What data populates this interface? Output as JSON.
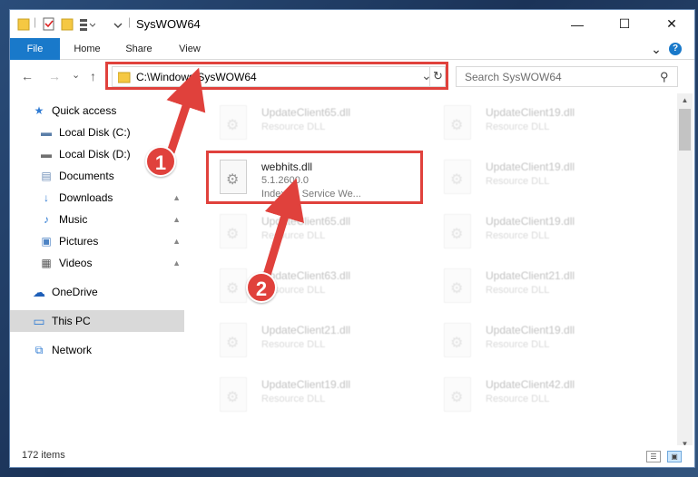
{
  "window": {
    "title": "SysWOW64",
    "minimize_glyph": "—",
    "maximize_glyph": "☐",
    "close_glyph": "✕"
  },
  "ribbon": {
    "tabs": [
      {
        "label": "File"
      },
      {
        "label": "Home"
      },
      {
        "label": "Share"
      },
      {
        "label": "View"
      }
    ],
    "expand_glyph": "⌄",
    "help_glyph": "?"
  },
  "address": {
    "path": "C:\\Windows\\SysWOW64",
    "dropdown_glyph": "⌄",
    "refresh_glyph": "↻"
  },
  "nav_buttons": {
    "back": "←",
    "forward": "→",
    "recent": "⌄",
    "up": "↑"
  },
  "search": {
    "placeholder": "Search SysWOW64",
    "icon": "search-icon",
    "glyph": "⚲"
  },
  "sidebar": {
    "items": [
      {
        "label": "Quick access",
        "icon": "star-icon",
        "glyph": "★",
        "color": "#2f7bd3"
      },
      {
        "label": "Local Disk (C:)",
        "icon": "drive-icon",
        "glyph": "▬",
        "color": "#5a7ea8"
      },
      {
        "label": "Local Disk (D:)",
        "icon": "drive-icon",
        "glyph": "▬",
        "color": "#6f6f6f"
      },
      {
        "label": "Documents",
        "icon": "document-icon",
        "glyph": "▤",
        "color": "#6f8fb8"
      },
      {
        "label": "Downloads",
        "icon": "download-icon",
        "glyph": "↓",
        "color": "#2f7bd3"
      },
      {
        "label": "Music",
        "icon": "music-icon",
        "glyph": "♪",
        "color": "#2f7bd3"
      },
      {
        "label": "Pictures",
        "icon": "picture-icon",
        "glyph": "▣",
        "color": "#4d83c4"
      },
      {
        "label": "Videos",
        "icon": "video-icon",
        "glyph": "▦",
        "color": "#555555"
      },
      {
        "label": "OneDrive",
        "icon": "cloud-icon",
        "glyph": "☁",
        "color": "#1e5fb8"
      },
      {
        "label": "This PC",
        "icon": "computer-icon",
        "glyph": "▭",
        "color": "#2f7bd3"
      },
      {
        "label": "Network",
        "icon": "network-icon",
        "glyph": "⧉",
        "color": "#2f7bd3"
      }
    ],
    "pin_glyph": "📌"
  },
  "files": {
    "left_column": [
      {
        "name": "UpdateClient65.dll",
        "type": "Resource DLL"
      },
      {
        "name": "webhits.dll",
        "version": "5.1.2600.0",
        "description": "Indexing Service We..."
      },
      {
        "name": "UpdateClient65.dll",
        "type": "Resource DLL"
      },
      {
        "name": "UpdateClient63.dll",
        "type": "Resource DLL"
      },
      {
        "name": "UpdateClient21.dll",
        "type": "Resource DLL"
      },
      {
        "name": "UpdateClient19.dll",
        "type": "Resource DLL"
      }
    ],
    "right_column": [
      {
        "name": "UpdateClient19.dll",
        "type": "Resource DLL"
      },
      {
        "name": "UpdateClient19.dll",
        "type": "Resource DLL"
      },
      {
        "name": "UpdateClient19.dll",
        "type": "Resource DLL"
      },
      {
        "name": "UpdateClient21.dll",
        "type": "Resource DLL"
      },
      {
        "name": "UpdateClient19.dll",
        "type": "Resource DLL"
      },
      {
        "name": "UpdateClient42.dll",
        "type": "Resource DLL"
      }
    ]
  },
  "status": {
    "item_count": "172 items"
  },
  "annotations": {
    "badge1": "1",
    "badge2": "2",
    "color": "#e0413c"
  },
  "colors": {
    "accent": "#1979ca",
    "highlight": "#e0413c",
    "selected": "#d9d9d9"
  }
}
